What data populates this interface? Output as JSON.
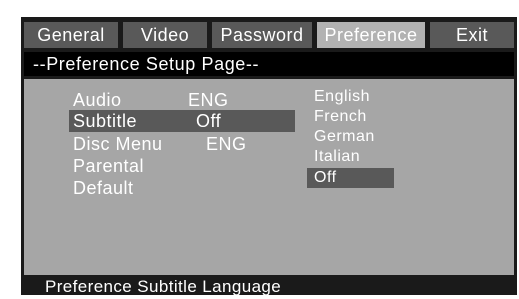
{
  "tabs": [
    {
      "label": "General",
      "active": false
    },
    {
      "label": "Video",
      "active": false
    },
    {
      "label": "Password",
      "active": false
    },
    {
      "label": "Preference",
      "active": true
    },
    {
      "label": "Exit",
      "active": false
    }
  ],
  "title": "--Preference Setup Page--",
  "settings": [
    {
      "label": "Audio",
      "value": "ENG",
      "selected": false
    },
    {
      "label": "Subtitle",
      "value": "Off",
      "selected": true
    },
    {
      "label": "Disc Menu",
      "value": "ENG",
      "selected": false
    },
    {
      "label": "Parental",
      "value": "",
      "selected": false
    },
    {
      "label": "Default",
      "value": "",
      "selected": false
    }
  ],
  "options": [
    {
      "label": "English",
      "selected": false
    },
    {
      "label": "French",
      "selected": false
    },
    {
      "label": "German",
      "selected": false
    },
    {
      "label": "Italian",
      "selected": false
    },
    {
      "label": "Off",
      "selected": true
    }
  ],
  "status": "Preference Subtitle Language",
  "colors": {
    "frame": "#1a1a1a",
    "tab_inactive": "#595959",
    "tab_active": "#b2b2b2",
    "content_bg": "#a6a6a6",
    "highlight": "#595959",
    "text": "#ffffff"
  }
}
